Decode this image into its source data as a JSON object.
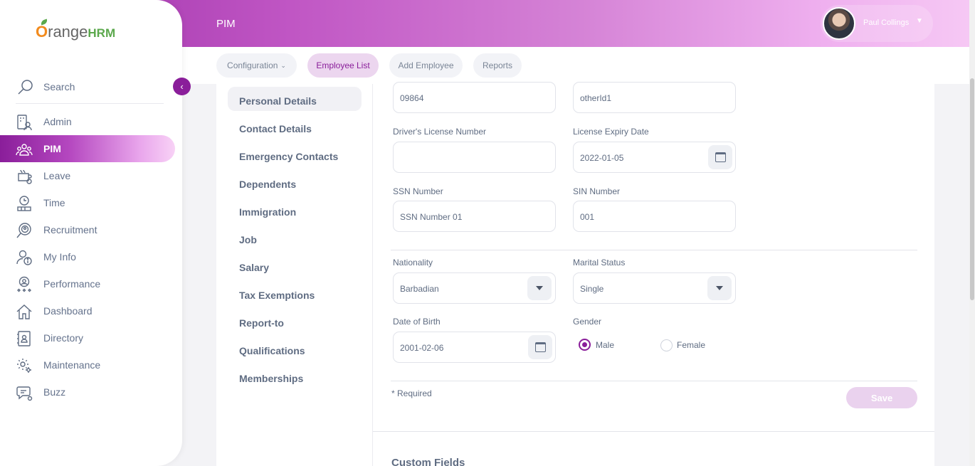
{
  "header": {
    "module_title": "PIM",
    "user_name": "Paul Collings"
  },
  "tabs": [
    {
      "label": "Configuration",
      "has_chevron": true
    },
    {
      "label": "Employee List",
      "active": true
    },
    {
      "label": "Add Employee"
    },
    {
      "label": "Reports"
    }
  ],
  "brand": {
    "logo_o": "O",
    "logo_range": "range",
    "logo_hrm": "HRM"
  },
  "sidebar": {
    "search_label": "Search",
    "items": [
      {
        "label": "Admin",
        "icon": "admin-icon"
      },
      {
        "label": "PIM",
        "icon": "pim-icon",
        "active": true
      },
      {
        "label": "Leave",
        "icon": "leave-icon"
      },
      {
        "label": "Time",
        "icon": "time-icon"
      },
      {
        "label": "Recruitment",
        "icon": "recruitment-icon"
      },
      {
        "label": "My Info",
        "icon": "my-info-icon"
      },
      {
        "label": "Performance",
        "icon": "performance-icon"
      },
      {
        "label": "Dashboard",
        "icon": "dashboard-icon"
      },
      {
        "label": "Directory",
        "icon": "directory-icon"
      },
      {
        "label": "Maintenance",
        "icon": "maintenance-icon"
      },
      {
        "label": "Buzz",
        "icon": "buzz-icon"
      }
    ]
  },
  "subnav": [
    {
      "label": "Personal Details",
      "active": true
    },
    {
      "label": "Contact Details"
    },
    {
      "label": "Emergency Contacts"
    },
    {
      "label": "Dependents"
    },
    {
      "label": "Immigration"
    },
    {
      "label": "Job"
    },
    {
      "label": "Salary"
    },
    {
      "label": "Tax Exemptions"
    },
    {
      "label": "Report-to"
    },
    {
      "label": "Qualifications"
    },
    {
      "label": "Memberships"
    }
  ],
  "form": {
    "employee_id_value": "09864",
    "other_id_value": "otherId1",
    "drivers_license_label": "Driver's License Number",
    "drivers_license_value": "",
    "license_expiry_label": "License Expiry Date",
    "license_expiry_value": "2022-01-05",
    "ssn_label": "SSN Number",
    "ssn_value": "SSN Number 01",
    "sin_label": "SIN Number",
    "sin_value": "001",
    "nationality_label": "Nationality",
    "nationality_value": "Barbadian",
    "marital_label": "Marital Status",
    "marital_value": "Single",
    "dob_label": "Date of Birth",
    "dob_value": "2001-02-06",
    "gender_label": "Gender",
    "gender_options": [
      "Male",
      "Female"
    ],
    "gender_selected": "Male",
    "required_note": "* Required",
    "save_label": "Save"
  },
  "custom_fields_title": "Custom Fields",
  "colors": {
    "accent": "#8a1e9a",
    "header_start": "#9c2fa8",
    "header_end": "#f6c8f4"
  }
}
